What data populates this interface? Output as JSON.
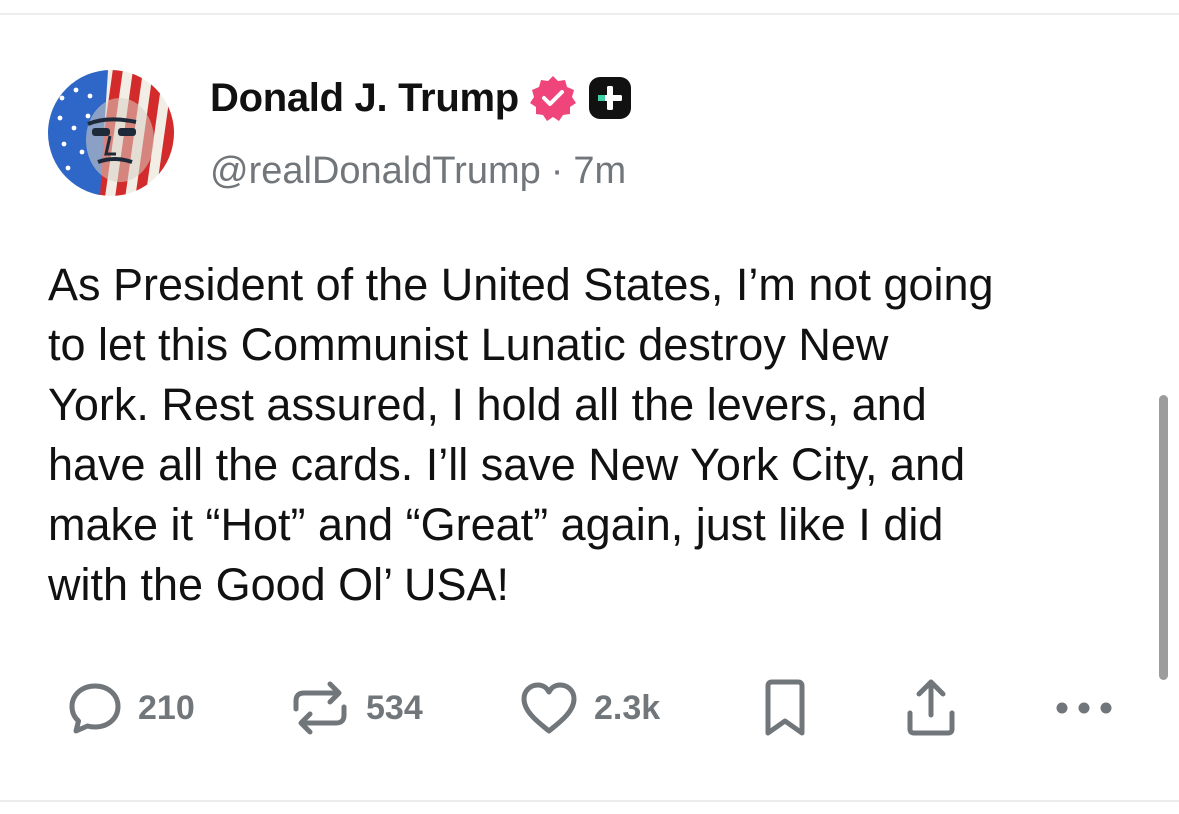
{
  "author": {
    "display_name": "Donald J. Trump",
    "handle": "@realDonaldTrump",
    "separator": "·",
    "timestamp": "7m",
    "avatar_icon": "flag-portrait-avatar",
    "verified_icon": "verified-badge-icon",
    "verified_color": "#f0457a",
    "plus_icon": "plus-badge-icon"
  },
  "post": {
    "text": "As President of the United States, I’m not going\nto let this Communist Lunatic destroy New\nYork. Rest assured, I hold all the levers, and\nhave all the cards. I’ll save New York City, and\nmake it “Hot” and “Great” again, just like I did\nwith the Good Ol’ USA!"
  },
  "actions": {
    "reply": {
      "icon": "reply-icon",
      "count": "210"
    },
    "repost": {
      "icon": "repost-icon",
      "count": "534"
    },
    "like": {
      "icon": "heart-icon",
      "count": "2.3k"
    },
    "bookmark": {
      "icon": "bookmark-icon"
    },
    "share": {
      "icon": "share-icon"
    },
    "more": {
      "icon": "more-icon"
    }
  },
  "colors": {
    "text": "#111111",
    "muted": "#71767b",
    "divider": "#ececec"
  }
}
